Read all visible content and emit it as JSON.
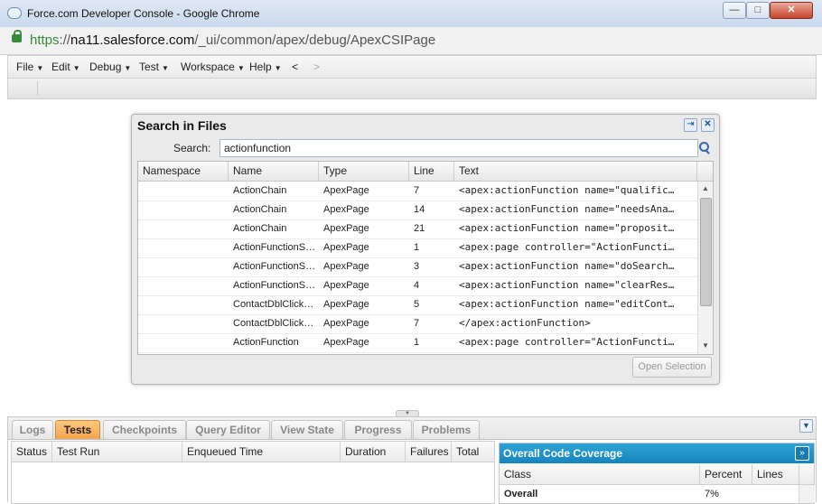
{
  "window": {
    "title": "Force.com Developer Console - Google Chrome",
    "controls": {
      "minimize": "—",
      "maximize": "□",
      "close": "✕"
    }
  },
  "address": {
    "scheme": "https",
    "separator": "://",
    "host": "na11.salesforce.com",
    "path": "/_ui/common/apex/debug/ApexCSIPage"
  },
  "menubar": {
    "items": [
      "File",
      "Edit",
      "Debug",
      "Test",
      "Workspace",
      "Help"
    ],
    "back": "<",
    "forward": ">"
  },
  "dialog": {
    "title": "Search in Files",
    "search_label": "Search:",
    "search_value": "actionfunction",
    "columns": [
      "Namespace",
      "Name",
      "Type",
      "Line",
      "Text"
    ],
    "rows": [
      {
        "namespace": "",
        "name": "ActionChain",
        "type": "ApexPage",
        "line": "7",
        "text": "<apex:actionFunction name=\"qualific…"
      },
      {
        "namespace": "",
        "name": "ActionChain",
        "type": "ApexPage",
        "line": "14",
        "text": "<apex:actionFunction name=\"needsAna…"
      },
      {
        "namespace": "",
        "name": "ActionChain",
        "type": "ApexPage",
        "line": "21",
        "text": "<apex:actionFunction name=\"proposit…"
      },
      {
        "namespace": "",
        "name": "ActionFunctionS…",
        "type": "ApexPage",
        "line": "1",
        "text": "<apex:page controller=\"ActionFuncti…"
      },
      {
        "namespace": "",
        "name": "ActionFunctionS…",
        "type": "ApexPage",
        "line": "3",
        "text": "<apex:actionFunction name=\"doSearch…"
      },
      {
        "namespace": "",
        "name": "ActionFunctionS…",
        "type": "ApexPage",
        "line": "4",
        "text": "<apex:actionFunction name=\"clearRes…"
      },
      {
        "namespace": "",
        "name": "ContactDblClick…",
        "type": "ApexPage",
        "line": "5",
        "text": "<apex:actionFunction name=\"editCont…"
      },
      {
        "namespace": "",
        "name": "ContactDblClick…",
        "type": "ApexPage",
        "line": "7",
        "text": "</apex:actionFunction>"
      },
      {
        "namespace": "",
        "name": "ActionFunction",
        "type": "ApexPage",
        "line": "1",
        "text": "<apex:page controller=\"ActionFuncti…"
      }
    ],
    "open_selection": "Open Selection"
  },
  "bottom": {
    "tabs": [
      "Logs",
      "Tests",
      "Checkpoints",
      "Query Editor",
      "View State",
      "Progress",
      "Problems"
    ],
    "active_tab": "Tests",
    "test_columns": [
      "Status",
      "Test Run",
      "Enqueued Time",
      "Duration",
      "Failures",
      "Total"
    ],
    "coverage": {
      "title": "Overall Code Coverage",
      "columns": [
        "Class",
        "Percent",
        "Lines"
      ],
      "row": {
        "class": "Overall",
        "percent": "7%"
      }
    }
  },
  "colors": {
    "active_tab": "#f2a44d",
    "coverage_header": "#1684bc",
    "https_green": "#3a8a3a"
  }
}
